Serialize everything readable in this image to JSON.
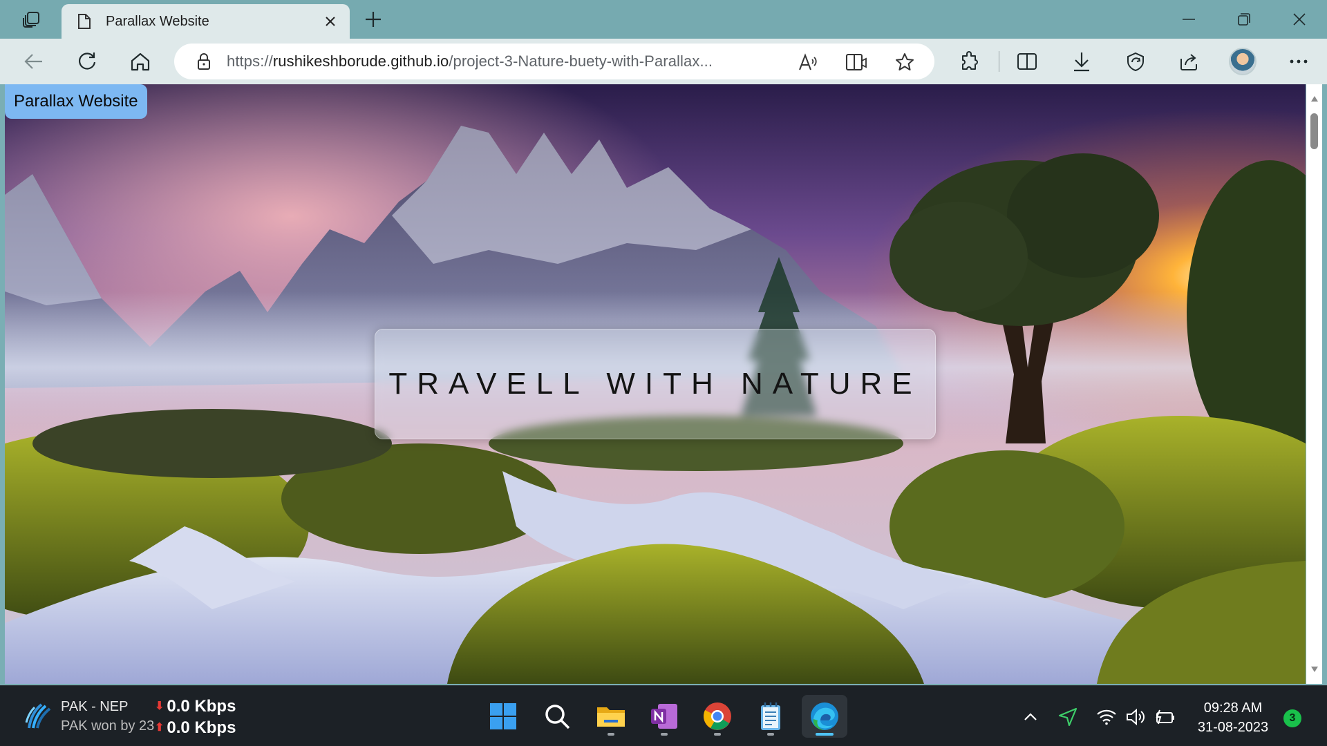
{
  "browser": {
    "tab": {
      "title": "Parallax Website"
    },
    "address": {
      "prefix": "https://",
      "domain": "rushikeshborude.github.io",
      "path": "/project-3-Nature-buety-with-Parallax..."
    },
    "icons": [
      "tab-actions-icon",
      "page-icon",
      "close-icon",
      "plus-icon",
      "minimize-icon",
      "maximize-icon",
      "window-close-icon",
      "back-icon",
      "refresh-icon",
      "home-icon",
      "lock-icon",
      "read-aloud-icon",
      "immersive-reader-icon",
      "favorite-star-icon",
      "extensions-icon",
      "split-screen-icon",
      "downloads-icon",
      "browser-essentials-icon",
      "share-icon",
      "more-icon"
    ]
  },
  "page": {
    "logo_text": "Parallax Website",
    "hero_title": "TRAVELL WITH NATURE"
  },
  "taskbar": {
    "news": {
      "title": "PAK - NEP",
      "subtitle": "PAK won by 23"
    },
    "net": {
      "down": "0.0 Kbps",
      "up": "0.0 Kbps"
    },
    "apps": [
      "start",
      "search",
      "file-explorer",
      "onenote",
      "chrome",
      "notepad",
      "edge"
    ],
    "clock": {
      "time": "09:28 AM",
      "date": "31-08-2023"
    },
    "notifications": "3"
  },
  "colors": {
    "titlebar": "#76aab0",
    "toolbar": "#dfe9ea",
    "logo_bg": "#7db8f2",
    "taskbar": "#1c2126",
    "notif_badge": "#19c14b"
  }
}
